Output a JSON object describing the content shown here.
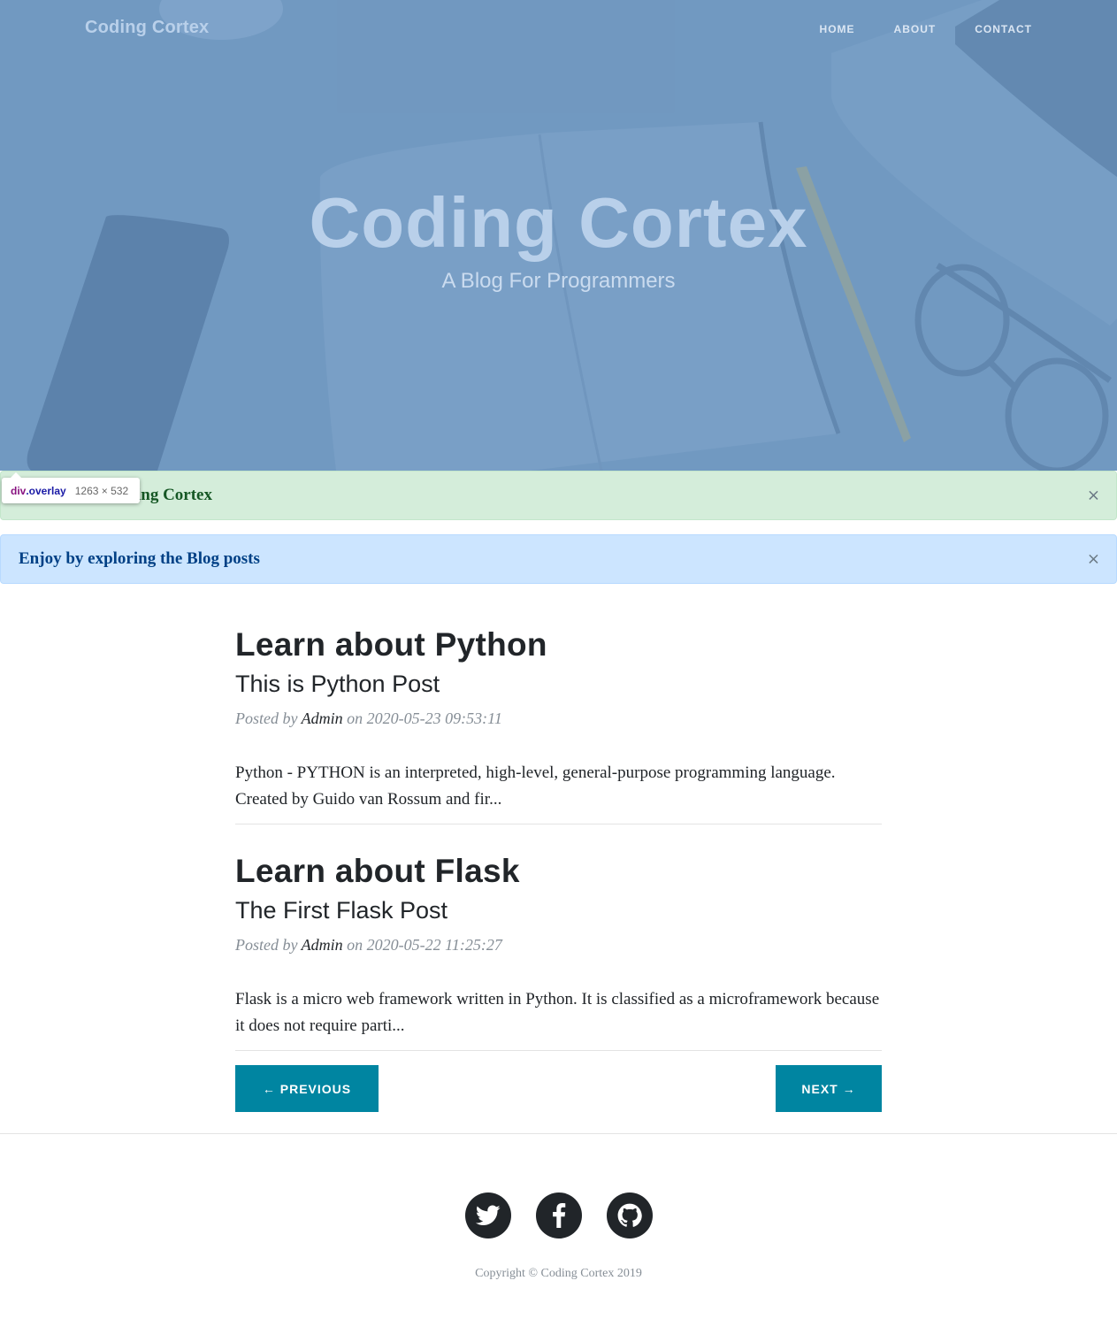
{
  "header": {
    "brand": "Coding Cortex",
    "nav": [
      "HOME",
      "ABOUT",
      "CONTACT"
    ],
    "title": "Coding Cortex",
    "subtitle": "A Blog For Programmers"
  },
  "inspector_tooltip": {
    "tag": "div",
    "class": ".overlay",
    "size": "1263 × 532"
  },
  "alerts": [
    {
      "text": "Welcome to Coding Cortex",
      "close": "×"
    },
    {
      "text": "Enjoy by exploring the Blog posts",
      "close": "×"
    }
  ],
  "posts": [
    {
      "title": "Learn about Python",
      "subtitle": "This is Python Post",
      "posted_by_prefix": "Posted by",
      "author": "Admin",
      "date_prefix": "on",
      "date": "2020-05-23 09:53:11",
      "excerpt": "Python - PYTHON is an interpreted, high-level, general-purpose programming language. Created by Guido van Rossum and fir..."
    },
    {
      "title": "Learn about Flask",
      "subtitle": "The First Flask Post",
      "posted_by_prefix": "Posted by",
      "author": "Admin",
      "date_prefix": "on",
      "date": "2020-05-22 11:25:27",
      "excerpt": "Flask is a micro web framework written in Python. It is classified as a microframework because it does not require parti..."
    }
  ],
  "pager": {
    "previous": "← PREVIOUS",
    "next": "NEXT →"
  },
  "footer": {
    "social_icons": [
      "twitter-icon",
      "facebook-icon",
      "github-icon"
    ],
    "copyright": "Copyright © Coding Cortex 2019"
  },
  "colors": {
    "hero_overlay": "#749cc4",
    "primary_button": "#0085a1",
    "alert_success_bg": "#d4edda",
    "alert_info_bg": "#cce5ff"
  }
}
